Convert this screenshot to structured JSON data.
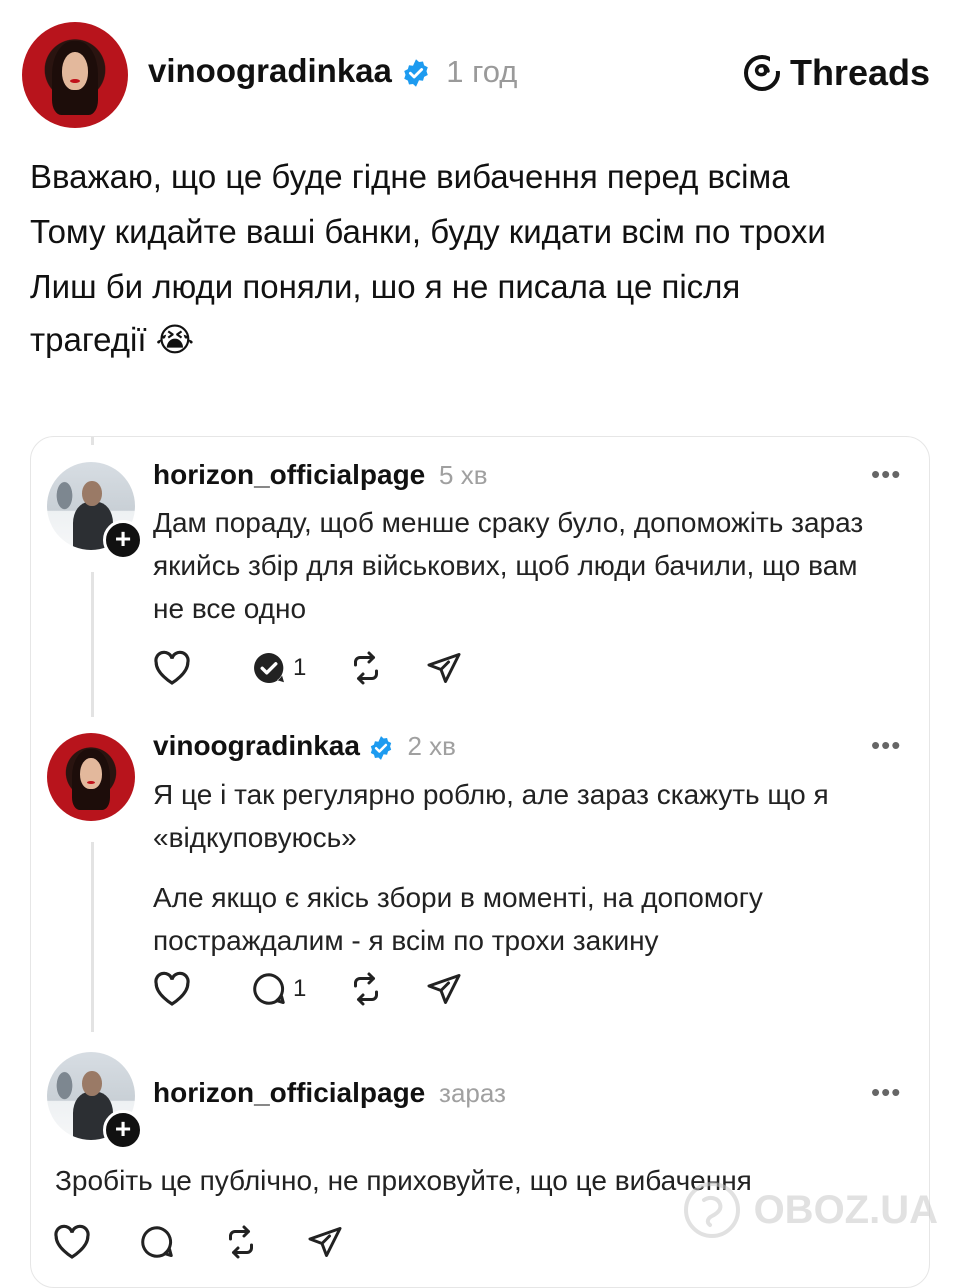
{
  "header": {
    "username": "vinoogradinkaa",
    "time": "1 год",
    "brand": "Threads",
    "accent": "#1d9bf0"
  },
  "post": {
    "lines": [
      "Вважаю, що це буде гідне вибачення перед всіма",
      "Тому кидайте ваші банки, буду кидати всім по трохи",
      "Лиш би люди поняли, шо я не писала це після трагедії 😭"
    ]
  },
  "comments": [
    {
      "username": "horizon_officialpage",
      "time": "5 хв",
      "paragraphs": [
        "Дам пораду, щоб менше сраку було, допоможіть зараз якийсь збір для військових, щоб люди бачили, що вам не все одно"
      ],
      "reply_count": "1"
    },
    {
      "username": "vinoogradinkaa",
      "time": "2 хв",
      "paragraphs": [
        "Я це і так регулярно роблю, але зараз скажуть що я «відкуповуюсь»",
        "Але якщо є якісь збори в моменті, на допомогу постраждалим - я всім по трохи закину"
      ],
      "reply_count": "1"
    },
    {
      "username": "horizon_officialpage",
      "time": "зараз",
      "paragraphs": [
        "Зробіть це публічно, не приховуйте, що це вибачення"
      ]
    }
  ],
  "more_label": "•••",
  "watermark": "OBOZ.UA"
}
